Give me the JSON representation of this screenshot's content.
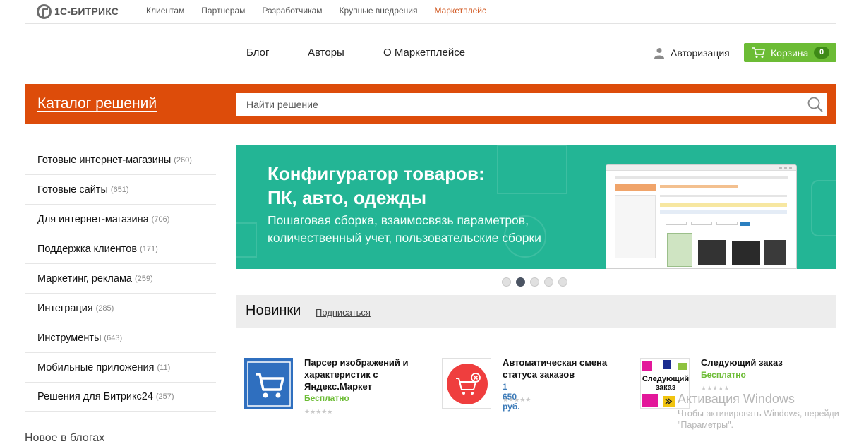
{
  "logo": {
    "text": "1С-БИТРИКС"
  },
  "topnav": [
    {
      "label": "Клиентам"
    },
    {
      "label": "Партнерам"
    },
    {
      "label": "Разработчикам"
    },
    {
      "label": "Крупные внедрения"
    },
    {
      "label": "Маркетплейс",
      "active": true
    }
  ],
  "mainnav": [
    {
      "label": "Блог"
    },
    {
      "label": "Авторы"
    },
    {
      "label": "О Маркетплейсе"
    }
  ],
  "auth": {
    "label": "Авторизация"
  },
  "cart": {
    "label": "Корзина",
    "count": "0"
  },
  "catalog": {
    "title": "Каталог решений",
    "search_placeholder": "Найти решение"
  },
  "sidebar": {
    "items": [
      {
        "label": "Готовые интернет-магазины",
        "count": "(260)"
      },
      {
        "label": "Готовые сайты",
        "count": "(651)"
      },
      {
        "label": "Для интернет-магазина",
        "count": "(706)"
      },
      {
        "label": "Поддержка клиентов",
        "count": "(171)"
      },
      {
        "label": "Маркетинг, реклама",
        "count": "(259)"
      },
      {
        "label": "Интеграция",
        "count": "(285)"
      },
      {
        "label": "Инструменты",
        "count": "(643)"
      },
      {
        "label": "Мобильные приложения",
        "count": "(11)"
      },
      {
        "label": "Решения для Битрикс24",
        "count": "(257)"
      }
    ],
    "blog_heading": "Новое в блогах"
  },
  "banner": {
    "title_line1": "Конфигуратор товаров:",
    "title_line2": "ПК, авто, одежды",
    "sub_line1": "Пошаговая сборка, взаимосвязь параметров,",
    "sub_line2": "количественный учет, пользовательские сборки",
    "slides": 5,
    "active_slide": 2
  },
  "news": {
    "title": "Новинки",
    "subscribe": "Подписаться",
    "products": [
      {
        "name": "Парсер изображений и характеристик с Яндекс.Маркет",
        "price": "Бесплатно",
        "price_color": "#6cbc35",
        "icon": "cart-icon"
      },
      {
        "name": "Автоматическая смена статуса заказов",
        "price": "1 650 руб.",
        "price_color": "#3d7bb8",
        "icon": "cart-cancel-icon"
      },
      {
        "name": "Следующий заказ",
        "price": "Бесплатно",
        "price_color": "#6cbc35",
        "icon": "next-order-icon",
        "image_text_line1": "Следующий",
        "image_text_line2": "заказ"
      }
    ]
  },
  "watermark": {
    "line1": "Активация Windows",
    "line2": "Чтобы активировать Windows, перейди",
    "line3": "\"Параметры\"."
  }
}
